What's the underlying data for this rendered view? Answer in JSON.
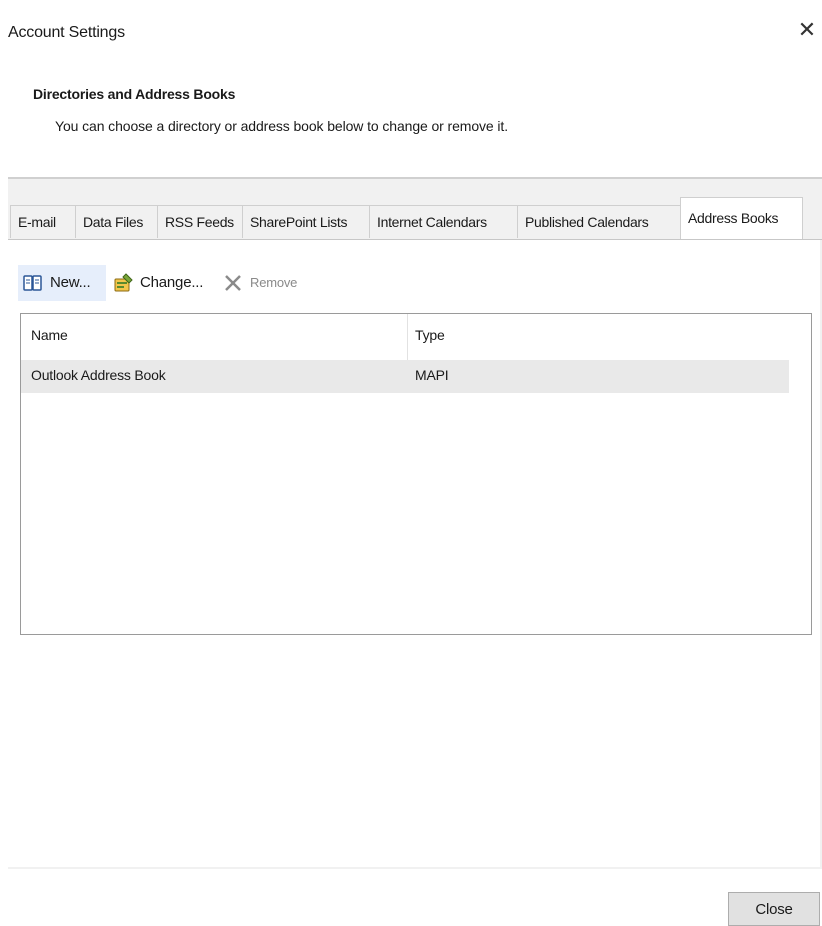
{
  "window": {
    "title": "Account Settings",
    "close_glyph": "✕"
  },
  "header": {
    "title": "Directories and Address Books",
    "description": "You can choose a directory or address book below to change or remove it."
  },
  "tabs": [
    {
      "label": "E-mail",
      "active": false
    },
    {
      "label": "Data Files",
      "active": false
    },
    {
      "label": "RSS Feeds",
      "active": false
    },
    {
      "label": "SharePoint Lists",
      "active": false
    },
    {
      "label": "Internet Calendars",
      "active": false
    },
    {
      "label": "Published Calendars",
      "active": false
    },
    {
      "label": "Address Books",
      "active": true
    }
  ],
  "toolbar": {
    "new_label": "New...",
    "change_label": "Change...",
    "remove_label": "Remove",
    "new_icon": "address-book-icon",
    "change_icon": "change-address-book-icon",
    "remove_icon": "remove-x-icon"
  },
  "list": {
    "columns": [
      "Name",
      "Type"
    ],
    "rows": [
      {
        "name": "Outlook Address Book",
        "type": "MAPI",
        "selected": true
      }
    ]
  },
  "footer": {
    "close_label": "Close"
  },
  "colors": {
    "panel_bg": "#f1f1f1",
    "selected_row": "#e9e9e9",
    "toolbar_hover": "#e6eefb",
    "button_bg": "#e1e1e1"
  }
}
